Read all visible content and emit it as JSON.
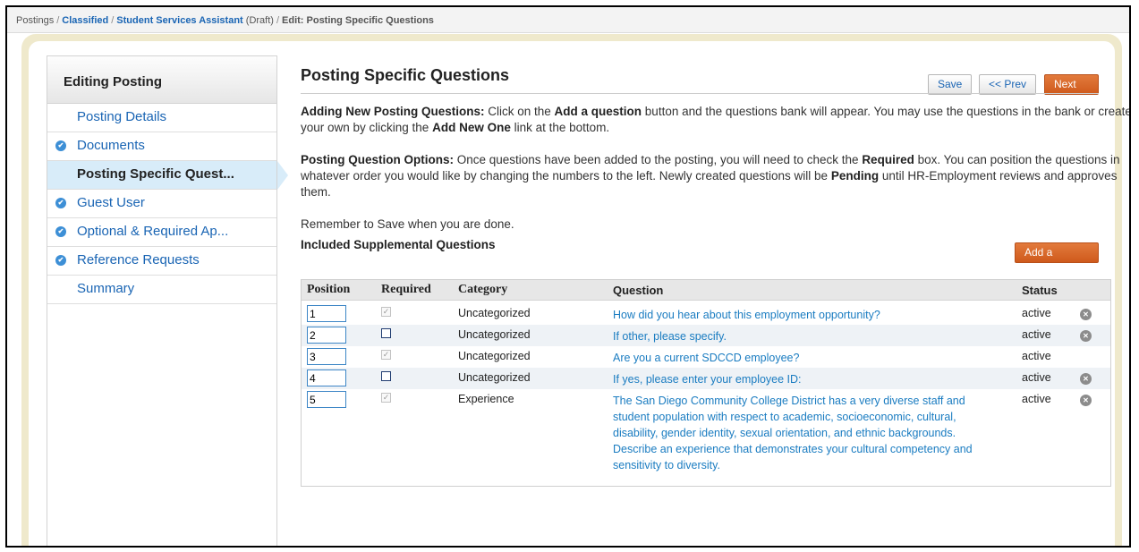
{
  "breadcrumb": {
    "root": "Postings",
    "classified": "Classified",
    "posting": "Student Services Assistant",
    "posting_state": "(Draft)",
    "current": "Edit: Posting Specific Questions"
  },
  "sidebar": {
    "heading": "Editing Posting",
    "items": [
      {
        "label": "Posting Details",
        "done": false
      },
      {
        "label": "Documents",
        "done": true
      },
      {
        "label": "Posting Specific Quest...",
        "done": false,
        "active": true
      },
      {
        "label": "Guest User",
        "done": true
      },
      {
        "label": "Optional & Required Ap...",
        "done": true
      },
      {
        "label": "Reference Requests",
        "done": true
      },
      {
        "label": "Summary",
        "done": false
      }
    ]
  },
  "main": {
    "title": "Posting Specific Questions",
    "buttons": {
      "save": "Save",
      "prev": "<< Prev",
      "next": "Next >>"
    },
    "intro1": {
      "label": "Adding New Posting Questions:",
      "t1": " Click on the ",
      "b1": "Add a question",
      "t2": " button and the questions bank will appear. You may use the questions in the bank or create your own by clicking the ",
      "b2": "Add New One",
      "t3": " link at the bottom."
    },
    "intro2": {
      "label": "Posting Question Options:",
      "t1": " Once questions have been added to the posting, you will need to check the ",
      "b1": "Required",
      "t2": " box. You can position the questions in whatever order you would like by changing the numbers to the left. Newly created questions will be ",
      "b2": "Pending",
      "t3": " until HR-Employment reviews and approves them."
    },
    "reminder": "Remember to Save when you are done.",
    "included_heading": "Included Supplemental Questions",
    "add_question": "Add a question"
  },
  "table": {
    "headers": {
      "position": "Position",
      "required": "Required",
      "category": "Category",
      "question": "Question",
      "status": "Status"
    },
    "rows": [
      {
        "position": "1",
        "required": true,
        "category": "Uncategorized",
        "question": "How did you hear about this employment opportunity?",
        "status": "active",
        "removable": true
      },
      {
        "position": "2",
        "required": false,
        "category": "Uncategorized",
        "question": "If other, please specify.",
        "status": "active",
        "removable": true
      },
      {
        "position": "3",
        "required": true,
        "category": "Uncategorized",
        "question": "Are you a current SDCCD employee?",
        "status": "active",
        "removable": false
      },
      {
        "position": "4",
        "required": false,
        "category": "Uncategorized",
        "question": "If yes, please enter your employee ID:",
        "status": "active",
        "removable": true
      },
      {
        "position": "5",
        "required": true,
        "category": "Experience",
        "question": "The San Diego Community College District has a very diverse staff and student population with respect to academic, socioeconomic, cultural, disability, gender identity, sexual orientation, and ethnic backgrounds. Describe an experience that demonstrates your cultural competency and sensitivity to diversity.",
        "status": "active",
        "removable": true
      }
    ]
  },
  "colors": {
    "link": "#1a65b4",
    "accent_orange": "#d9642a",
    "active_nav": "#d8ecf9"
  }
}
